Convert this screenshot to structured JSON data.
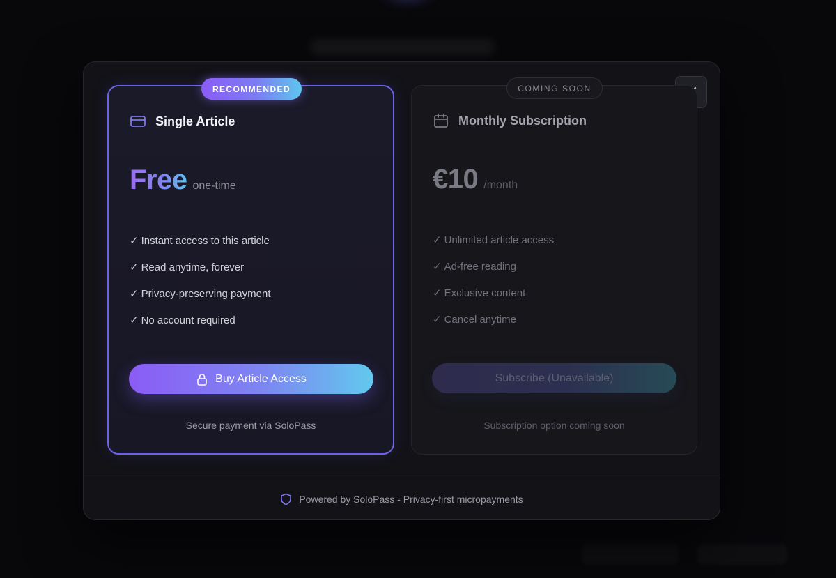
{
  "modal": {
    "close_label": "Close"
  },
  "plans": {
    "single": {
      "badge": "RECOMMENDED",
      "icon": "credit-card-icon",
      "title": "Single Article",
      "price": "Free",
      "price_unit": "one-time",
      "features": [
        "Instant access to this article",
        "Read anytime, forever",
        "Privacy-preserving payment",
        "No account required"
      ],
      "cta_label": "Buy Article Access",
      "cta_icon": "lock-icon",
      "footnote": "Secure payment via SoloPass"
    },
    "monthly": {
      "badge": "COMING SOON",
      "icon": "calendar-icon",
      "title": "Monthly Subscription",
      "price": "€10",
      "price_unit": "/month",
      "features": [
        "Unlimited article access",
        "Ad-free reading",
        "Exclusive content",
        "Cancel anytime"
      ],
      "cta_label": "Subscribe (Unavailable)",
      "footnote": "Subscription option coming soon"
    }
  },
  "footer": {
    "icon": "shield-icon",
    "text": "Powered by SoloPass - Privacy-first micropayments"
  },
  "colors": {
    "accent_purple": "#8b5cf6",
    "accent_cyan": "#62c9ee",
    "card_border": "#6b63e6"
  },
  "check_glyph": "✓"
}
